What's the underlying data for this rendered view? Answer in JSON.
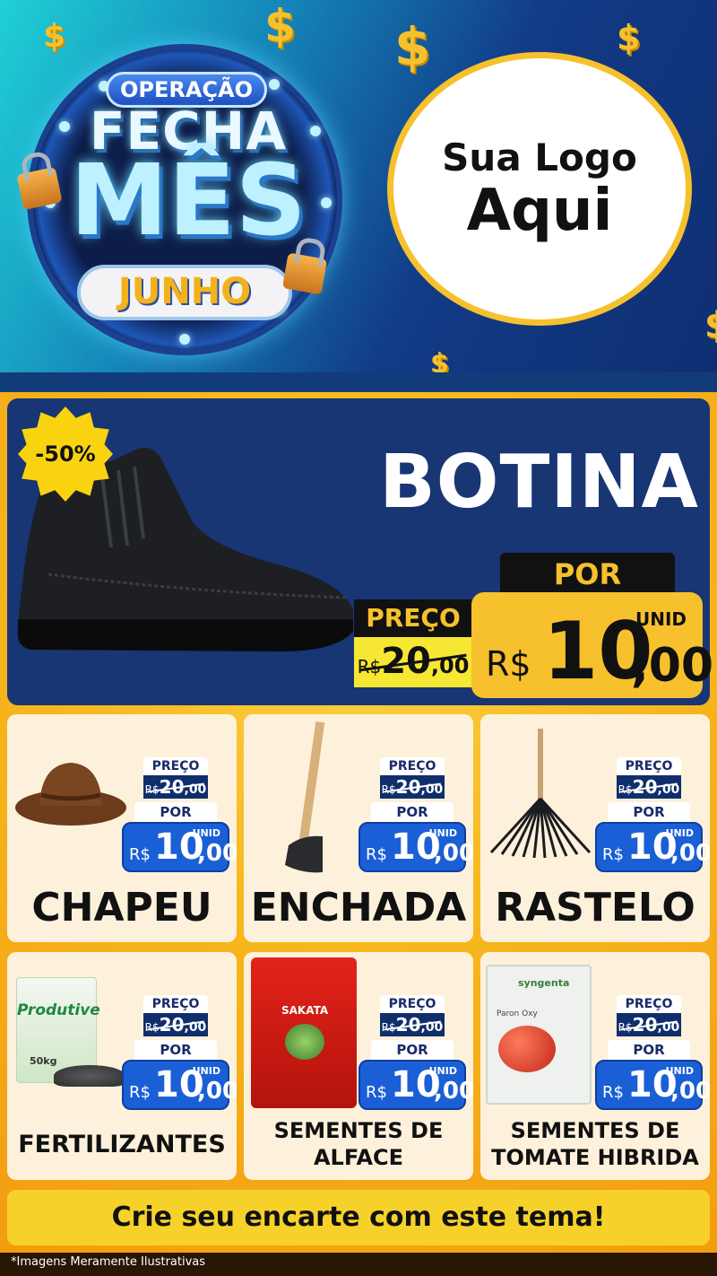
{
  "banner": {
    "badge_line1": "OPERAÇÃO",
    "badge_line2": "FECHA",
    "badge_line3": "MÊS",
    "badge_line4": "JUNHO",
    "logo_line1": "Sua Logo",
    "logo_line2": "Aqui",
    "dollar_symbol": "$"
  },
  "hero": {
    "discount": "-50%",
    "title": "BOTINA",
    "por_label": "POR",
    "preco_label": "PREÇO",
    "old_currency": "R$",
    "old_int": "20",
    "old_cents": ",00",
    "unit": "UNID",
    "currency": "R$",
    "new_int": "10",
    "new_cents": ",00"
  },
  "products": [
    {
      "name": "CHAPEU",
      "preco_label": "PREÇO",
      "old_currency": "R$",
      "old_int": "20",
      "old_cents": ",00",
      "por_label": "POR",
      "unit": "UNID",
      "currency": "R$",
      "new_int": "10",
      "new_cents": ",00"
    },
    {
      "name": "ENCHADA",
      "preco_label": "PREÇO",
      "old_currency": "R$",
      "old_int": "20",
      "old_cents": ",00",
      "por_label": "POR",
      "unit": "UNID",
      "currency": "R$",
      "new_int": "10",
      "new_cents": ",00"
    },
    {
      "name": "RASTELO",
      "preco_label": "PREÇO",
      "old_currency": "R$",
      "old_int": "20",
      "old_cents": ",00",
      "por_label": "POR",
      "unit": "UNID",
      "currency": "R$",
      "new_int": "10",
      "new_cents": ",00"
    },
    {
      "name": "FERTILIZANTES",
      "preco_label": "PREÇO",
      "old_currency": "R$",
      "old_int": "20",
      "old_cents": ",00",
      "por_label": "POR",
      "unit": "UNID",
      "currency": "R$",
      "new_int": "10",
      "new_cents": ",00",
      "package_text": "Produtive",
      "package_weight": "50kg"
    },
    {
      "name_line1": "SEMENTES DE",
      "name_line2": "ALFACE",
      "preco_label": "PREÇO",
      "old_currency": "R$",
      "old_int": "20",
      "old_cents": ",00",
      "por_label": "POR",
      "unit": "UNID",
      "currency": "R$",
      "new_int": "10",
      "new_cents": ",00",
      "package_brand": "SAKATA"
    },
    {
      "name_line1": "SEMENTES DE",
      "name_line2": "TOMATE HIBRIDA",
      "preco_label": "PREÇO",
      "old_currency": "R$",
      "old_int": "20",
      "old_cents": ",00",
      "por_label": "POR",
      "unit": "UNID",
      "currency": "R$",
      "new_int": "10",
      "new_cents": ",00",
      "package_brand": "syngenta",
      "package_product": "Paron Oxy"
    }
  ],
  "cta": "Crie seu encarte com este tema!",
  "footer": "*Imagens Meramente Ilustrativas",
  "colors": {
    "accent_yellow": "#f6c12c",
    "navy": "#183574",
    "price_blue": "#1b5fd6"
  }
}
